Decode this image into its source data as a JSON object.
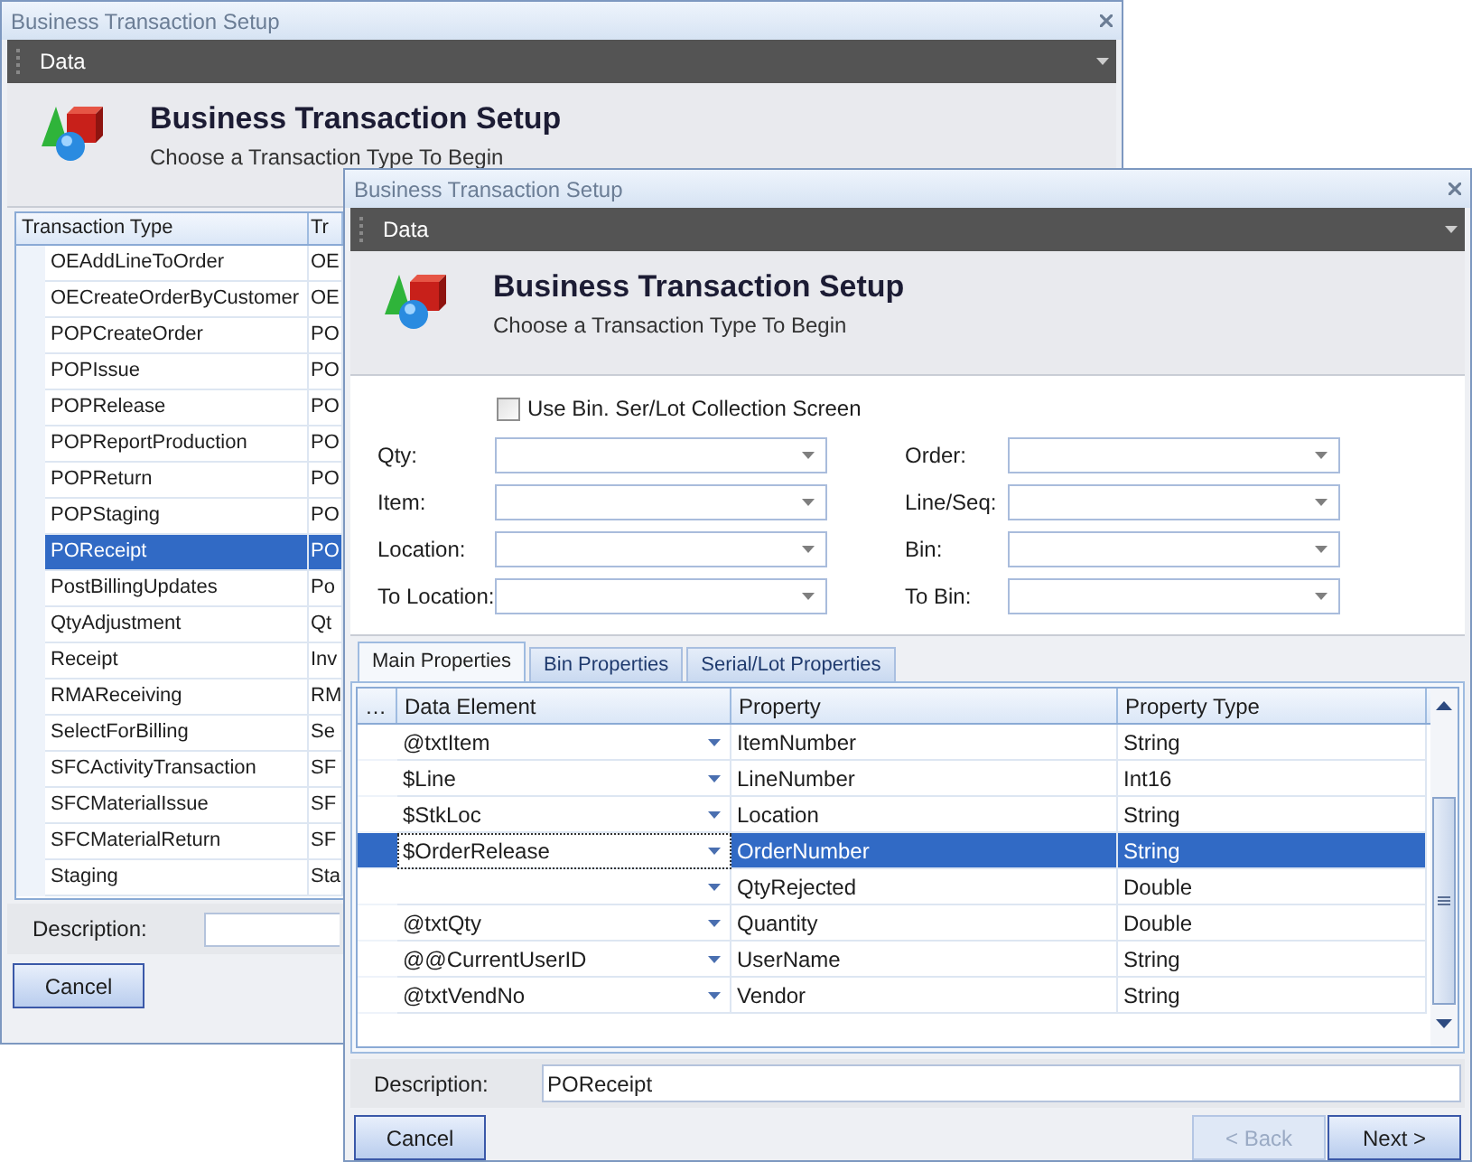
{
  "back_window": {
    "title": "Business Transaction Setup",
    "menu_bar": {
      "label": "Data"
    },
    "header": {
      "title": "Business Transaction Setup",
      "subtitle": "Choose a Transaction Type To Begin"
    },
    "grid": {
      "columns": [
        "Transaction Type",
        "Tr"
      ],
      "rows": [
        {
          "cells": [
            "OEAddLineToOrder",
            "OE"
          ],
          "selected": false
        },
        {
          "cells": [
            "OECreateOrderByCustomer",
            "OE"
          ],
          "selected": false
        },
        {
          "cells": [
            "POPCreateOrder",
            "PO"
          ],
          "selected": false
        },
        {
          "cells": [
            "POPIssue",
            "PO"
          ],
          "selected": false
        },
        {
          "cells": [
            "POPRelease",
            "PO"
          ],
          "selected": false
        },
        {
          "cells": [
            "POPReportProduction",
            "PO"
          ],
          "selected": false
        },
        {
          "cells": [
            "POPReturn",
            "PO"
          ],
          "selected": false
        },
        {
          "cells": [
            "POPStaging",
            "PO"
          ],
          "selected": false
        },
        {
          "cells": [
            "POReceipt",
            "PO"
          ],
          "selected": true
        },
        {
          "cells": [
            "PostBillingUpdates",
            "Po"
          ],
          "selected": false
        },
        {
          "cells": [
            "QtyAdjustment",
            "Qt"
          ],
          "selected": false
        },
        {
          "cells": [
            "Receipt",
            "Inv"
          ],
          "selected": false
        },
        {
          "cells": [
            "RMAReceiving",
            "RM"
          ],
          "selected": false
        },
        {
          "cells": [
            "SelectForBilling",
            "Se"
          ],
          "selected": false
        },
        {
          "cells": [
            "SFCActivityTransaction",
            "SF"
          ],
          "selected": false
        },
        {
          "cells": [
            "SFCMaterialIssue",
            "SF"
          ],
          "selected": false
        },
        {
          "cells": [
            "SFCMaterialReturn",
            "SF"
          ],
          "selected": false
        },
        {
          "cells": [
            "Staging",
            "Sta"
          ],
          "selected": false
        }
      ]
    },
    "description": {
      "label": "Description:"
    },
    "buttons": [
      {
        "label": "Cancel"
      }
    ]
  },
  "front_window": {
    "title": "Business Transaction Setup",
    "menu_bar": {
      "label": "Data"
    },
    "header": {
      "title": "Business Transaction Setup",
      "subtitle": "Choose a Transaction Type To Begin"
    },
    "use_bin_checkbox": {
      "label": "Use Bin. Ser/Lot Collection Screen",
      "checked": false
    },
    "left_fields": [
      {
        "label": "Qty:"
      },
      {
        "label": "Item:"
      },
      {
        "label": "Location:"
      },
      {
        "label": "To Location:"
      }
    ],
    "right_fields": [
      {
        "label": "Order:"
      },
      {
        "label": "Line/Seq:"
      },
      {
        "label": "Bin:"
      },
      {
        "label": "To Bin:"
      }
    ],
    "tabs": [
      {
        "label": "Main Properties",
        "selected": true
      },
      {
        "label": "Bin Properties",
        "selected": false
      },
      {
        "label": "Serial/Lot Properties",
        "selected": false
      }
    ],
    "grid": {
      "columns": [
        "…",
        "Data Element",
        "Property",
        "Property Type"
      ],
      "rows": [
        {
          "data_element": "@txtItem",
          "property": "ItemNumber",
          "property_type": "String",
          "selected": false
        },
        {
          "data_element": "$Line",
          "property": "LineNumber",
          "property_type": "Int16",
          "selected": false
        },
        {
          "data_element": "$StkLoc",
          "property": "Location",
          "property_type": "String",
          "selected": false
        },
        {
          "data_element": "$OrderRelease",
          "property": "OrderNumber",
          "property_type": "String",
          "selected": true
        },
        {
          "property": "QtyRejected",
          "property_type": "Double",
          "selected": false
        },
        {
          "data_element": "@txtQty",
          "property": "Quantity",
          "property_type": "Double",
          "selected": false
        },
        {
          "data_element": "@@CurrentUserID",
          "property": "UserName",
          "property_type": "String",
          "selected": false
        },
        {
          "data_element": "@txtVendNo",
          "property": "Vendor",
          "property_type": "String",
          "selected": false
        }
      ]
    },
    "description": {
      "label": "Description:",
      "value": "POReceipt"
    },
    "buttons": [
      {
        "label": "Cancel",
        "disabled": false
      },
      {
        "label": "< Back",
        "disabled": true
      },
      {
        "label": "Next >",
        "disabled": false
      }
    ]
  }
}
